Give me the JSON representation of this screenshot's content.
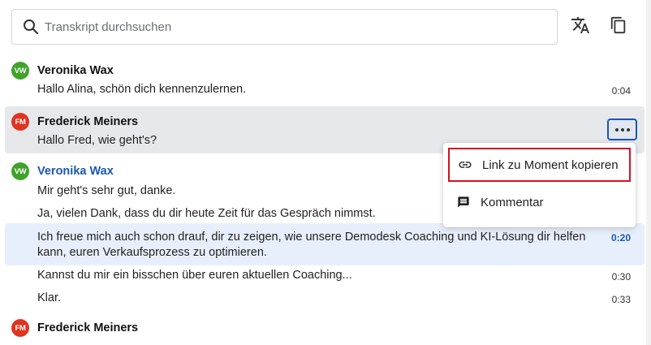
{
  "search": {
    "placeholder": "Transkript durchsuchen"
  },
  "toolbar": {
    "translate_icon": "translate-icon",
    "copy_icon": "copy-icon"
  },
  "colors": {
    "accent": "#1a56b4",
    "avatar_green": "#3fa32a",
    "avatar_red": "#e0331f",
    "highlight": "#d4121f"
  },
  "transcript": [
    {
      "initials": "VW",
      "speaker": "Veronika Wax",
      "lines": [
        {
          "text": "Hallo Alina, schön dich kennenzulernen.",
          "time": "0:04"
        }
      ]
    },
    {
      "initials": "FM",
      "speaker": "Frederick Meiners",
      "lines": [
        {
          "text": "Hallo Fred, wie geht's?",
          "time": ""
        }
      ]
    },
    {
      "initials": "VW",
      "speaker": "Veronika Wax",
      "lines": [
        {
          "text": "Mir geht's sehr gut, danke.",
          "time": ""
        },
        {
          "text": "Ja, vielen Dank, dass du dir heute Zeit für das Gespräch nimmst.",
          "time": ""
        },
        {
          "text": "Ich freue mich auch schon drauf, dir zu zeigen, wie unsere Demodesk Coaching und KI-Lösung dir helfen",
          "text2": "kann, euren Verkaufsprozess zu optimieren.",
          "time": "0:20"
        },
        {
          "text": "Kannst du mir ein bisschen über euren aktuellen Coaching...",
          "time": "0:30"
        },
        {
          "text": "Klar.",
          "time": "0:33"
        }
      ]
    },
    {
      "initials": "FM",
      "speaker": "Frederick Meiners",
      "lines": []
    }
  ],
  "context_menu": {
    "items": [
      {
        "label": "Link zu Moment kopieren",
        "icon": "link-icon"
      },
      {
        "label": "Kommentar",
        "icon": "comment-icon"
      }
    ]
  }
}
